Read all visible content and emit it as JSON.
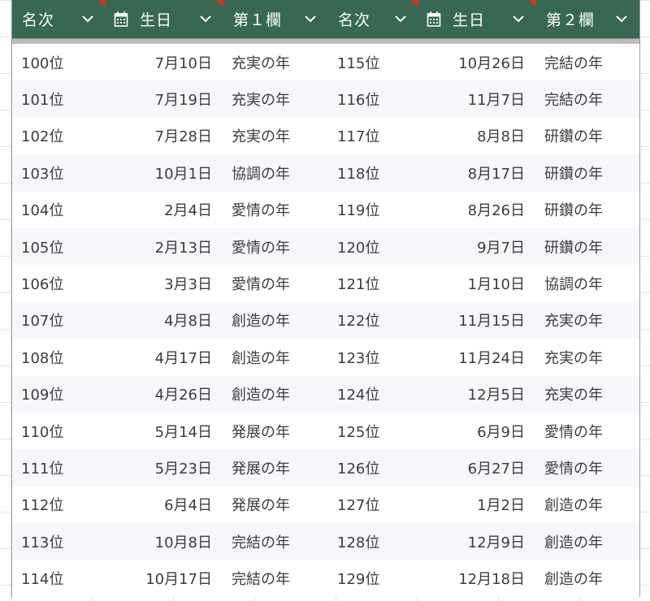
{
  "header": {
    "columns": [
      {
        "label": "名次",
        "icon": "chevron-down-icon"
      },
      {
        "label": "生日",
        "icon": "calendar-icon"
      },
      {
        "label": "第１欄",
        "icon": "chevron-down-icon"
      },
      {
        "label": "名次",
        "icon": "chevron-down-icon"
      },
      {
        "label": "生日",
        "icon": "calendar-icon"
      },
      {
        "label": "第２欄",
        "icon": "chevron-down-icon"
      }
    ]
  },
  "colors": {
    "header_bg": "#396852",
    "header_text": "#ffffff",
    "alt_row_bg": "#f5f7fb",
    "corner_marker": "#d93025"
  },
  "rows": [
    [
      "100位",
      "7月10日",
      "充実の年",
      "115位",
      "10月26日",
      "完結の年"
    ],
    [
      "101位",
      "7月19日",
      "充実の年",
      "116位",
      "11月7日",
      "完結の年"
    ],
    [
      "102位",
      "7月28日",
      "充実の年",
      "117位",
      "8月8日",
      "研鑽の年"
    ],
    [
      "103位",
      "10月1日",
      "協調の年",
      "118位",
      "8月17日",
      "研鑽の年"
    ],
    [
      "104位",
      "2月4日",
      "愛情の年",
      "119位",
      "8月26日",
      "研鑽の年"
    ],
    [
      "105位",
      "2月13日",
      "愛情の年",
      "120位",
      "9月7日",
      "研鑽の年"
    ],
    [
      "106位",
      "3月3日",
      "愛情の年",
      "121位",
      "1月10日",
      "協調の年"
    ],
    [
      "107位",
      "4月8日",
      "創造の年",
      "122位",
      "11月15日",
      "充実の年"
    ],
    [
      "108位",
      "4月17日",
      "創造の年",
      "123位",
      "11月24日",
      "充実の年"
    ],
    [
      "109位",
      "4月26日",
      "創造の年",
      "124位",
      "12月5日",
      "充実の年"
    ],
    [
      "110位",
      "5月14日",
      "発展の年",
      "125位",
      "6月9日",
      "愛情の年"
    ],
    [
      "111位",
      "5月23日",
      "発展の年",
      "126位",
      "6月27日",
      "愛情の年"
    ],
    [
      "112位",
      "6月4日",
      "発展の年",
      "127位",
      "1月2日",
      "創造の年"
    ],
    [
      "113位",
      "10月8日",
      "完結の年",
      "128位",
      "12月9日",
      "創造の年"
    ],
    [
      "114位",
      "10月17日",
      "完結の年",
      "129位",
      "12月18日",
      "創造の年"
    ]
  ]
}
